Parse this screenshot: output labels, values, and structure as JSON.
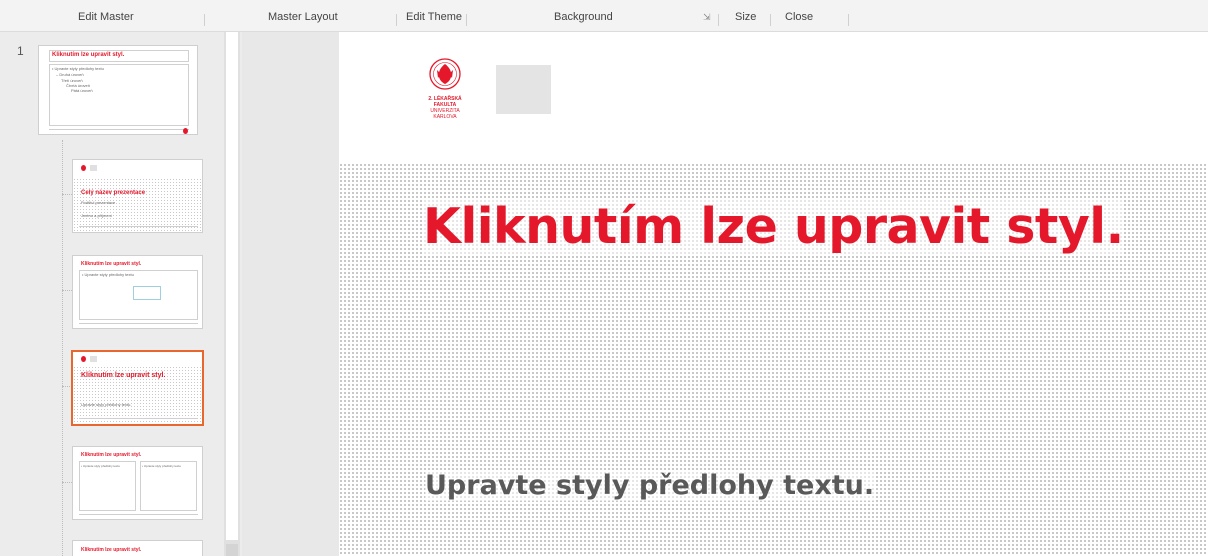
{
  "ribbon": {
    "groups": {
      "edit_master": "Edit Master",
      "master_layout": "Master Layout",
      "edit_theme": "Edit Theme",
      "background": "Background",
      "size": "Size",
      "close": "Close"
    },
    "dialog_launcher_icon": "dialog-launcher-icon"
  },
  "thumbnail_pane": {
    "master_number": "1",
    "master": {
      "title": "Kliknutím lze upravit styl.",
      "body": "• Upravte styly předlohy textu",
      "level2": "– Druhá úroveň",
      "level3": "Třetí úroveň",
      "level4": "Čtvrtá úroveň",
      "level5": "Pátá úroveň"
    },
    "layouts": [
      {
        "title": "Celý název prezentace",
        "line1": "Podtitul prezentace",
        "line2": "Jméno a příjmení"
      },
      {
        "title": "Kliknutím lze upravit styl.",
        "body": "• Upravte styly předlohy textu"
      },
      {
        "title": "Kliknutím lze upravit styl.",
        "body": "Upravte styly předlohy textu."
      },
      {
        "title": "Kliknutím lze upravit styl.",
        "body_left": "• Upravte styly předlohy textu",
        "body_right": "• Upravte styly předlohy textu"
      },
      {
        "title": "Kliknutím lze upravit styl."
      }
    ]
  },
  "slide": {
    "logo_text": [
      "2. LÉKAŘSKÁ",
      "FAKULTA",
      "UNIVERZITA",
      "KARLOVA"
    ],
    "title": "Kliknutím lze upravit styl.",
    "subtitle": "Upravte styly předlohy textu."
  },
  "colors": {
    "accent_red": "#e4182a",
    "selection_orange": "#e8672e",
    "subtitle_gray": "#595959"
  }
}
